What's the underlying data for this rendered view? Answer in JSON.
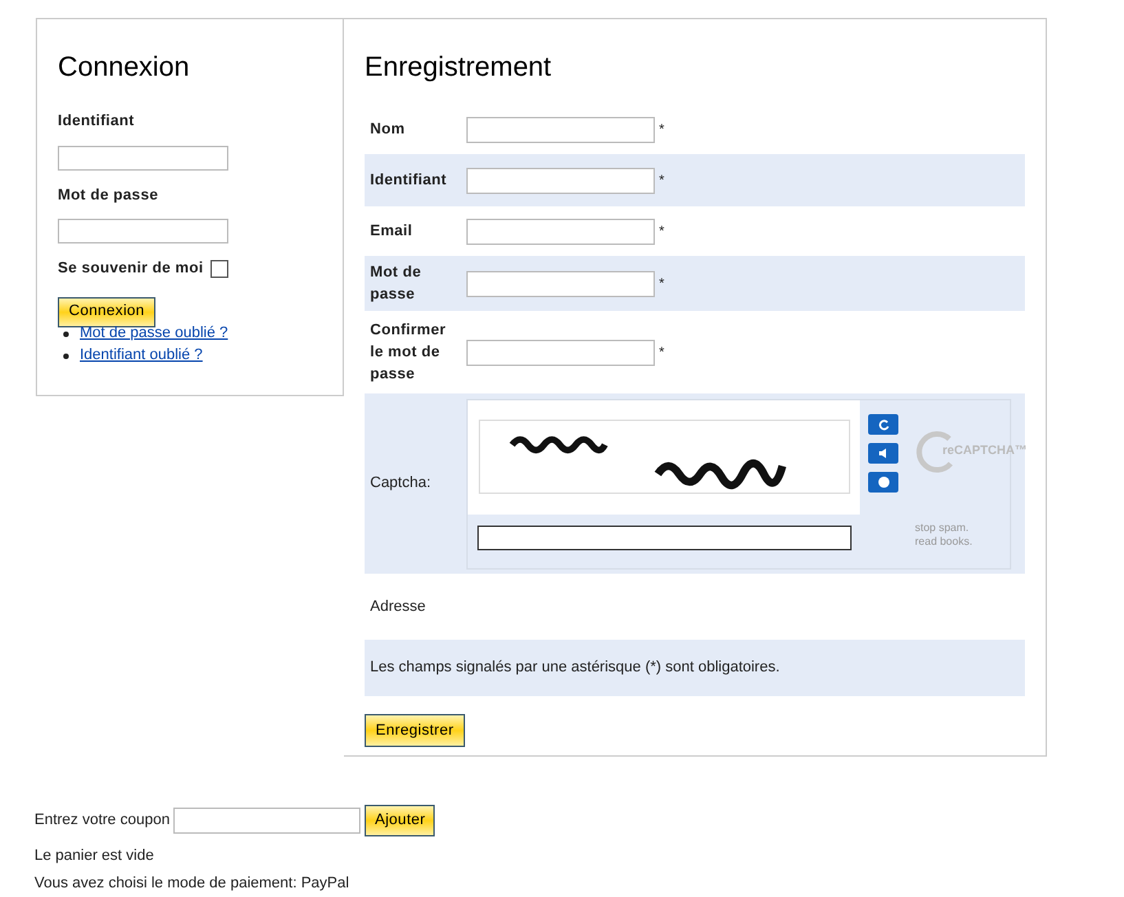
{
  "login": {
    "title": "Connexion",
    "fields": [
      {
        "label": "Identifiant"
      },
      {
        "label": "Mot de passe"
      }
    ],
    "remember": {
      "label": "Se souvenir de moi",
      "checked": false
    },
    "button": "Connexion",
    "links": [
      "Mot de passe oublié ?",
      "Identifiant oublié ?"
    ]
  },
  "register": {
    "title": "Enregistrement",
    "rows": [
      {
        "kind": "field",
        "label": "Nom",
        "marker": "*"
      },
      {
        "kind": "field",
        "label": "Identifiant",
        "marker": "*"
      },
      {
        "kind": "field",
        "label": "Email",
        "marker": "*"
      },
      {
        "kind": "field",
        "label": "Mot de passe",
        "marker": "*"
      },
      {
        "kind": "field",
        "label": "Confirmer le mot de passe",
        "marker": "*"
      },
      {
        "kind": "captcha",
        "label": "Captcha:",
        "logo": "reCAPTCHA™",
        "slogan": [
          "stop spam.",
          "read books."
        ]
      },
      {
        "kind": "text",
        "label": "Adresse"
      },
      {
        "kind": "note",
        "label": "Les champs signalés par une astérisque (*) sont obligatoires."
      }
    ],
    "button": "Enregistrer"
  },
  "coupon": {
    "label": "Entrez votre coupon",
    "button": "Ajouter"
  },
  "cart": "Le panier est vide",
  "payment": "Vous avez choisi le mode de paiement: PayPal"
}
